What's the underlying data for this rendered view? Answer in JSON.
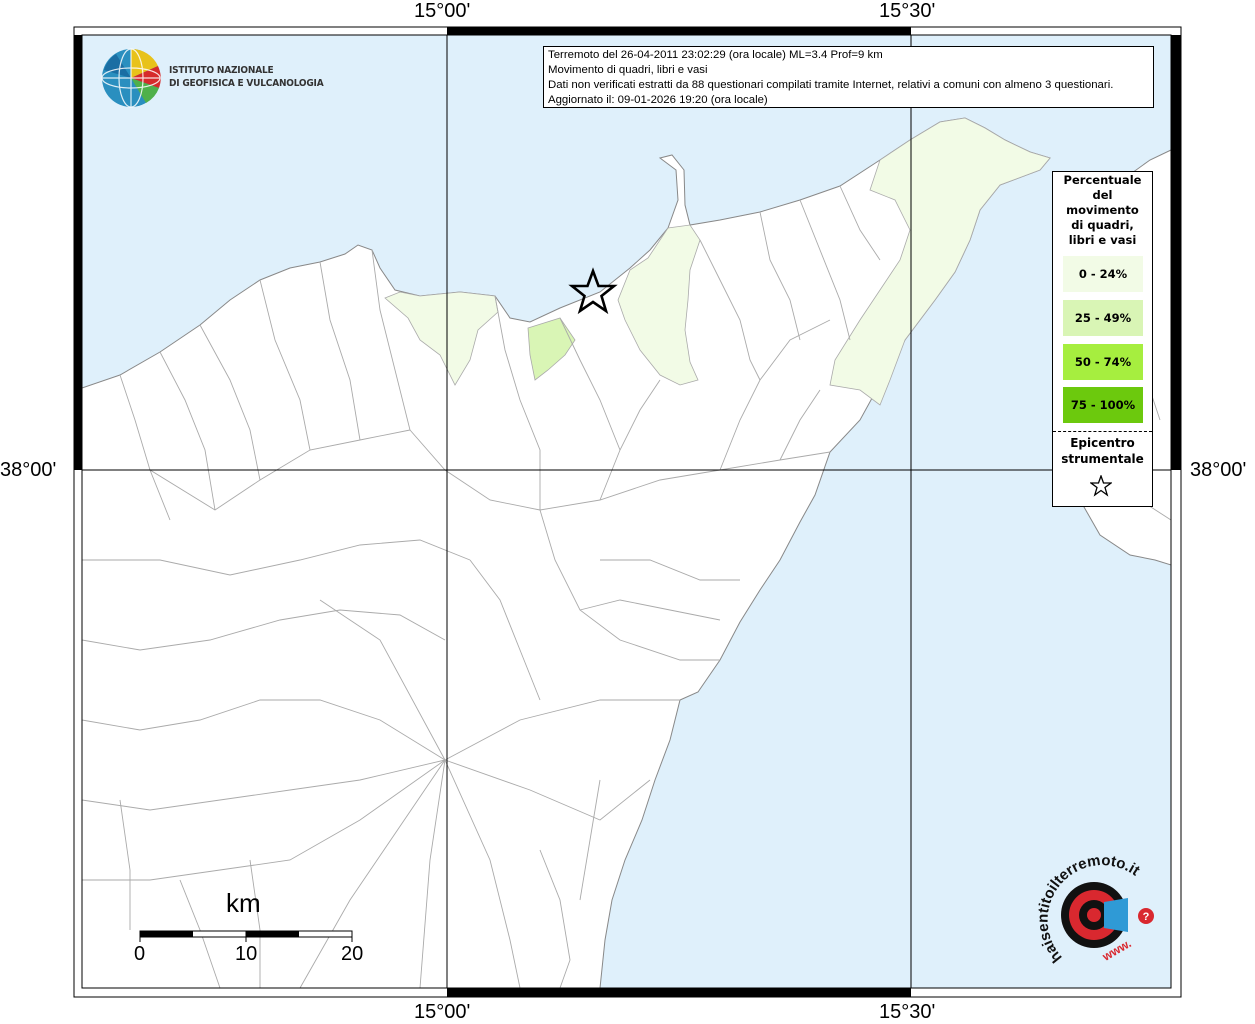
{
  "logo": {
    "institute_line1": "ISTITUTO NAZIONALE",
    "institute_line2": "DI GEOFISICA E VULCANOLOGIA",
    "site_logo_text": "haisentitoilterremoto.it",
    "site_logo_www": "www."
  },
  "info": {
    "line1": "Terremoto del 26-04-2011 23:02:29 (ora locale) ML=3.4 Prof=9 km",
    "line2": "Movimento di quadri, libri e vasi",
    "line3": "Dati non verificati estratti da 88 questionari compilati tramite Internet, relativi a comuni con almeno 3 questionari.",
    "line4": "Aggiornato il: 09-01-2026 19:20 (ora locale)"
  },
  "coordinates": {
    "top_left": "15°00'",
    "top_right": "15°30'",
    "bottom_left": "15°00'",
    "bottom_right": "15°30'",
    "left_lat": "38°00'",
    "right_lat": "38°00'"
  },
  "legend": {
    "title": "Percentuale del movimento di quadri, libri e vasi",
    "classes": [
      {
        "label": "0 - 24%",
        "color": "#f2fbe6"
      },
      {
        "label": "25 - 49%",
        "color": "#d9f5b5"
      },
      {
        "label": "50 - 74%",
        "color": "#a6ee3f"
      },
      {
        "label": "75 - 100%",
        "color": "#6cc90d"
      }
    ],
    "epicenter_label": "Epicentro strumentale"
  },
  "scale": {
    "unit": "km",
    "ticks": [
      "0",
      "10",
      "20"
    ]
  },
  "colors": {
    "sea": "#dff0fb",
    "land": "#ffffff",
    "boundary": "#aaaaaa",
    "frame": "#000000"
  }
}
